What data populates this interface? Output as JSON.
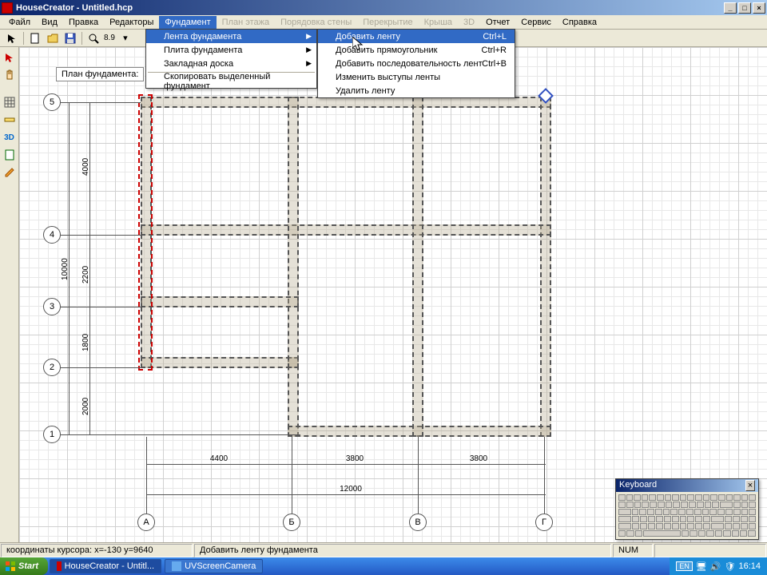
{
  "window": {
    "title": "HouseCreator - Untitled.hcp"
  },
  "win_buttons": {
    "min": "_",
    "max": "□",
    "close": "×"
  },
  "menu": {
    "items": [
      "Файл",
      "Вид",
      "Правка",
      "Редакторы",
      "Фундамент",
      "План этажа",
      "Порядовка стены",
      "Перекрытие",
      "Крыша",
      "3D",
      "Отчет",
      "Сервис",
      "Справка"
    ],
    "active_index": 4,
    "disabled_indices": [
      5,
      6,
      7,
      8,
      9
    ]
  },
  "toolbar": {
    "zoom_value": "8.9"
  },
  "dropdown1": {
    "items": [
      {
        "label": "Лента фундамента",
        "submenu": true,
        "highlight": true
      },
      {
        "label": "Плита фундамента",
        "submenu": true
      },
      {
        "label": "Закладная доска",
        "submenu": true
      },
      {
        "sep": true
      },
      {
        "label": "Скопировать выделенный фундамент"
      }
    ]
  },
  "dropdown2": {
    "items": [
      {
        "label": "Добавить ленту",
        "shortcut": "Ctrl+L",
        "highlight": true
      },
      {
        "label": "Добавить прямоугольник",
        "shortcut": "Ctrl+R"
      },
      {
        "label": "Добавить последовательность лент",
        "shortcut": "Ctrl+B"
      },
      {
        "label": "Изменить выступы ленты"
      },
      {
        "label": "Удалить ленту"
      }
    ]
  },
  "plan": {
    "title": "План фундамента:",
    "axes_v": [
      "5",
      "4",
      "3",
      "2",
      "1"
    ],
    "axes_h": [
      "А",
      "Б",
      "В",
      "Г"
    ],
    "dims_v": [
      "4000",
      "2200",
      "1800",
      "2000",
      "10000"
    ],
    "dims_h": [
      "4400",
      "3800",
      "3800",
      "12000"
    ]
  },
  "status": {
    "coords": "координаты курсора: x=-130 y=9640",
    "hint": "Добавить ленту фундамента",
    "indicator": "NUM"
  },
  "taskbar": {
    "start": "Start",
    "tasks": [
      "HouseCreator - Untitl...",
      "UVScreenCamera"
    ],
    "lang": "EN",
    "clock": "16:14"
  },
  "osk": {
    "title": "Keyboard"
  }
}
